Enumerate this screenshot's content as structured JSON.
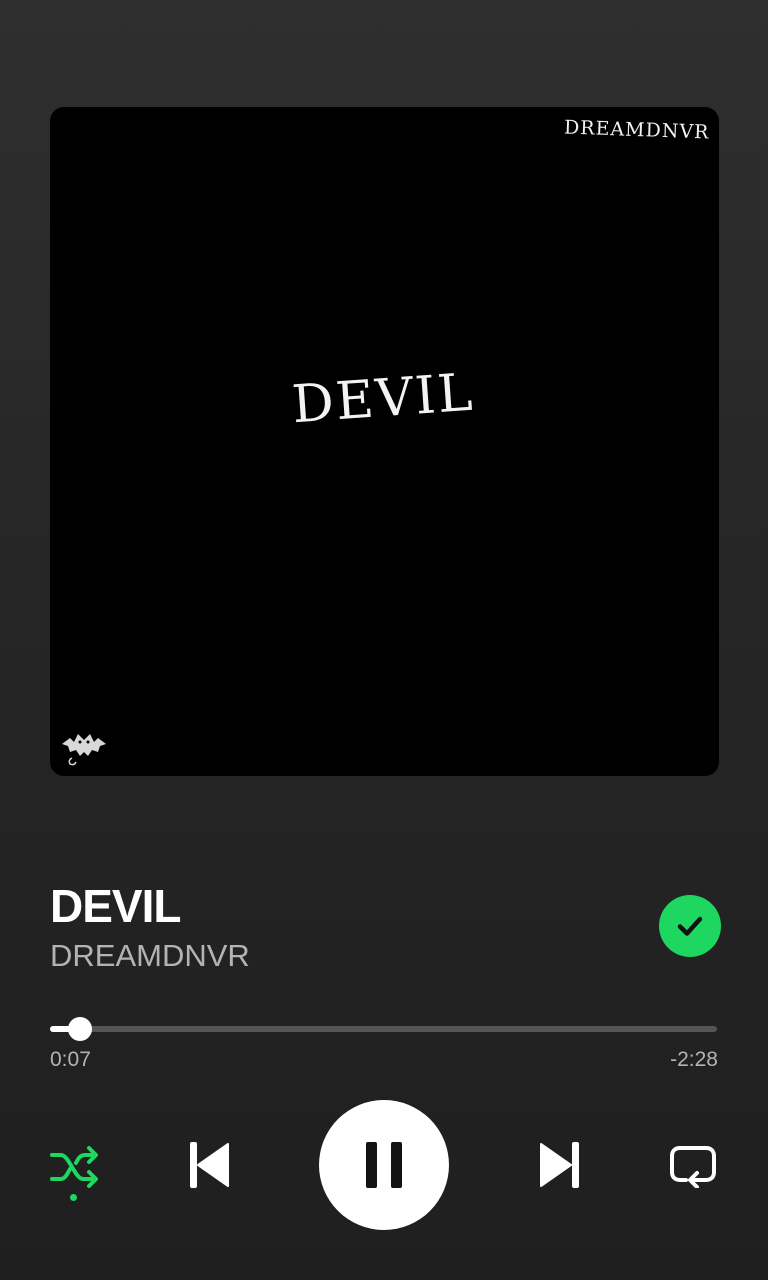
{
  "artwork": {
    "brand_text": "DREAMDNVR",
    "title_text": "DEVIL"
  },
  "track": {
    "title": "DEVIL",
    "artist": "DREAMDNVR",
    "saved": true
  },
  "playback": {
    "elapsed": "0:07",
    "remaining": "-2:28",
    "progress_fraction": 0.045,
    "state": "playing",
    "shuffle_on": true,
    "repeat_on": false
  },
  "colors": {
    "accent": "#1ed760",
    "background": "#262626",
    "secondary_text": "#b3b3b3"
  },
  "icons": {
    "saved": "check-icon",
    "shuffle": "shuffle-icon",
    "previous": "skip-previous-icon",
    "play_pause": "pause-icon",
    "next": "skip-next-icon",
    "repeat": "repeat-icon"
  }
}
